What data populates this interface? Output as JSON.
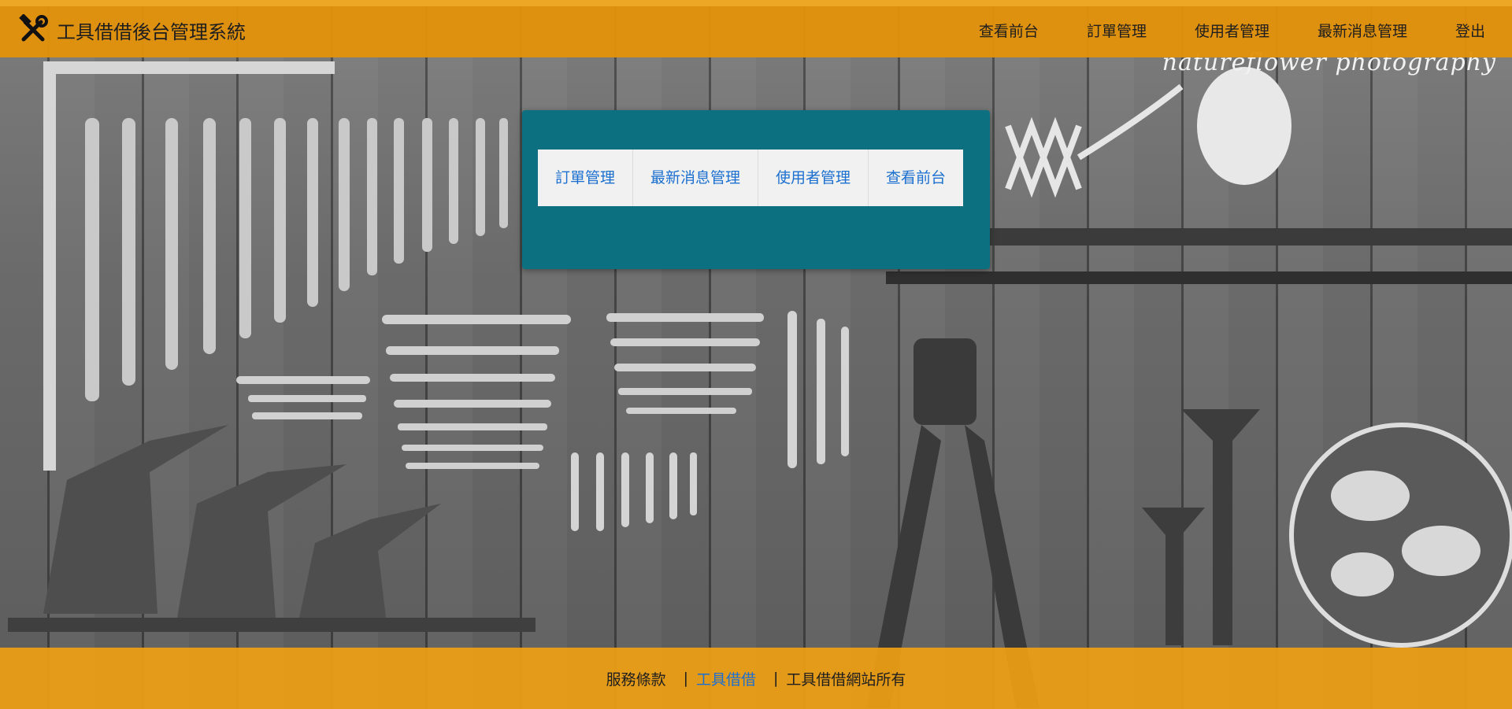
{
  "header": {
    "brand_icon": "hammer-wrench-icon",
    "title": "工具借借後台管理系統",
    "nav": [
      {
        "label": "查看前台"
      },
      {
        "label": "訂單管理"
      },
      {
        "label": "使用者管理"
      },
      {
        "label": "最新消息管理"
      },
      {
        "label": "登出"
      }
    ]
  },
  "background": {
    "watermark": "natureflower photography"
  },
  "panel": {
    "tabs": [
      {
        "label": "訂單管理"
      },
      {
        "label": "最新消息管理"
      },
      {
        "label": "使用者管理"
      },
      {
        "label": "查看前台"
      }
    ]
  },
  "footer": {
    "links": [
      {
        "label": "服務條款"
      },
      {
        "label": "工具借借"
      },
      {
        "label": "工具借借網站所有"
      }
    ],
    "separator": "|"
  },
  "colors": {
    "header_bg": "#e2910a",
    "footer_bg": "#f0a014",
    "panel_bg": "#0d7080",
    "tab_bg": "#f1f1f1",
    "link_blue": "#1b6fd0"
  }
}
